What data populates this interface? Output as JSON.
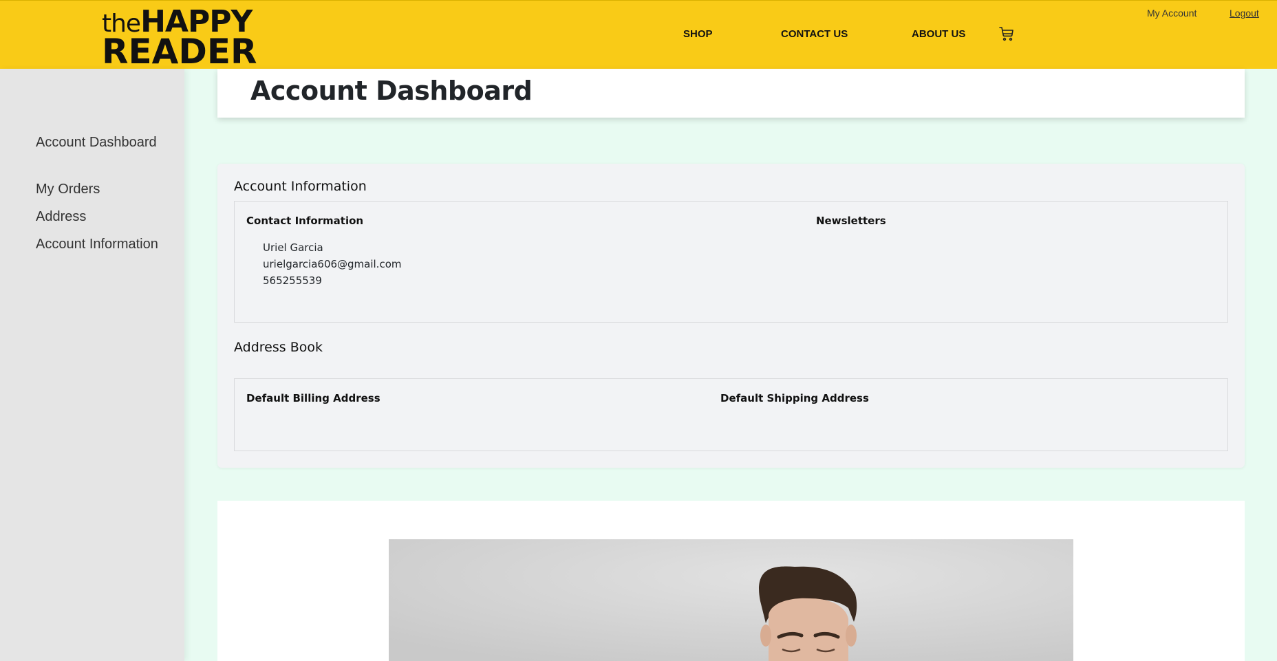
{
  "header": {
    "logo": {
      "the": "the",
      "happy": "HAPPY",
      "reader": "READER"
    },
    "nav": {
      "shop": "SHOP",
      "contact": "CONTACT US",
      "about": "ABOUT US"
    },
    "cart_icon": "cart-icon",
    "my_account": "My Account",
    "logout": "Logout"
  },
  "sidebar": {
    "items": [
      {
        "label": "Account Dashboard"
      },
      {
        "label": "My Orders"
      },
      {
        "label": "Address"
      },
      {
        "label": "Account Information"
      }
    ]
  },
  "page": {
    "title": "Account Dashboard"
  },
  "account_information": {
    "heading": "Account Information",
    "contact_label": "Contact Information",
    "name": "Uriel Garcia",
    "email": "urielgarcia606@gmail.com",
    "phone": "565255539",
    "newsletters_label": "Newsletters"
  },
  "address_book": {
    "heading": "Address Book",
    "billing_label": "Default Billing Address",
    "shipping_label": "Default Shipping Address"
  },
  "colors": {
    "header_bg": "#f9cb17",
    "page_bg": "#e8fbf2",
    "sidebar_bg": "#e5e5e5"
  }
}
